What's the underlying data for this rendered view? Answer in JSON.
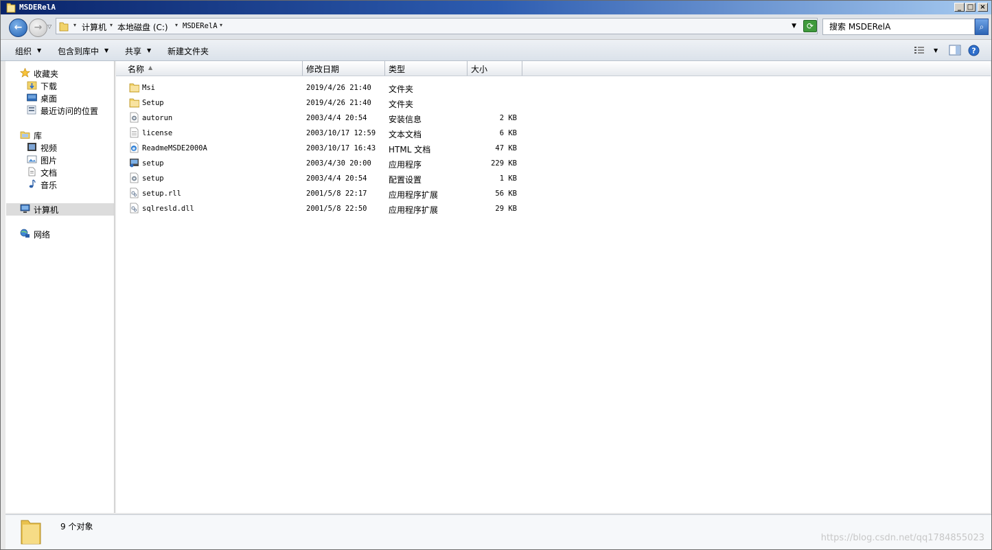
{
  "window": {
    "title": "MSDERelA"
  },
  "address": {
    "crumbs": [
      "计算机",
      "本地磁盘 (C:)",
      "MSDERelA"
    ],
    "search_placeholder": "搜索 MSDERelA"
  },
  "toolbar": {
    "organize": "组织",
    "include_library": "包含到库中",
    "share": "共享",
    "new_folder": "新建文件夹"
  },
  "nav": {
    "favorites": "收藏夹",
    "downloads": "下载",
    "desktop": "桌面",
    "recent": "最近访问的位置",
    "libraries": "库",
    "videos": "视频",
    "pictures": "图片",
    "documents": "文档",
    "music": "音乐",
    "computer": "计算机",
    "network": "网络"
  },
  "columns": {
    "name": "名称",
    "date": "修改日期",
    "type": "类型",
    "size": "大小"
  },
  "files": [
    {
      "name": "Msi",
      "date": "2019/4/26 21:40",
      "type": "文件夹",
      "size": "",
      "icon": "folder-icon"
    },
    {
      "name": "Setup",
      "date": "2019/4/26 21:40",
      "type": "文件夹",
      "size": "",
      "icon": "folder-icon"
    },
    {
      "name": "autorun",
      "date": "2003/4/4 20:54",
      "type": "安装信息",
      "size": "2 KB",
      "icon": "settings-file-icon"
    },
    {
      "name": "license",
      "date": "2003/10/17 12:59",
      "type": "文本文档",
      "size": "6 KB",
      "icon": "text-file-icon"
    },
    {
      "name": "ReadmeMSDE2000A",
      "date": "2003/10/17 16:43",
      "type": "HTML 文档",
      "size": "47 KB",
      "icon": "html-file-icon"
    },
    {
      "name": "setup",
      "date": "2003/4/30 20:00",
      "type": "应用程序",
      "size": "229 KB",
      "icon": "exe-file-icon"
    },
    {
      "name": "setup",
      "date": "2003/4/4 20:54",
      "type": "配置设置",
      "size": "1 KB",
      "icon": "settings-file-icon"
    },
    {
      "name": "setup.rll",
      "date": "2001/5/8 22:17",
      "type": "应用程序扩展",
      "size": "56 KB",
      "icon": "dll-file-icon"
    },
    {
      "name": "sqlresld.dll",
      "date": "2001/5/8 22:50",
      "type": "应用程序扩展",
      "size": "29 KB",
      "icon": "dll-file-icon"
    }
  ],
  "status": {
    "count_text": "9 个对象"
  },
  "watermark": "https://blog.csdn.net/qq1784855023"
}
